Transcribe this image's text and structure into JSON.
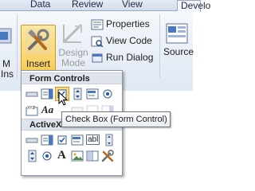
{
  "tabs": {
    "data": "Data",
    "review": "Review",
    "view": "View",
    "developer": "Develo"
  },
  "ribbon": {
    "left_partial_label_1": "M",
    "left_partial_label_2": "Ins",
    "insert_label": "Insert",
    "design_mode_label_1": "Design",
    "design_mode_label_2": "Mode",
    "properties_label": "Properties",
    "view_code_label": "View Code",
    "run_dialog_label": "Run Dialog",
    "source_label": "Source"
  },
  "gallery": {
    "form_controls_header": "Form Controls",
    "activex_header": "ActiveX",
    "aa_label": "Aa",
    "abl_label": "abl",
    "a_label": "A"
  },
  "tooltip": {
    "text": "Check Box (Form Control)"
  },
  "colors": {
    "insert_pressed": "#f8c64c",
    "ribbon_bg": "#dfe7f2"
  }
}
